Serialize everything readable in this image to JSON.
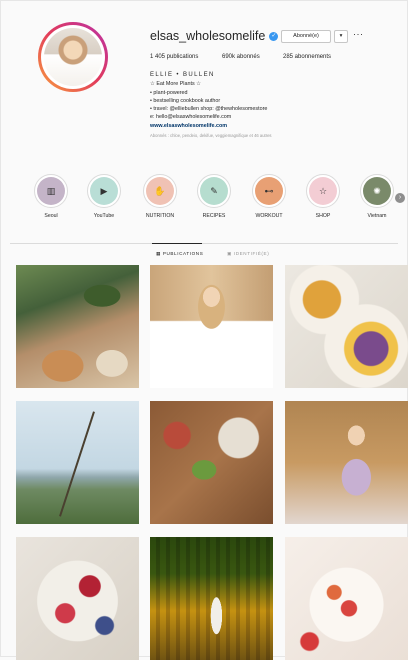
{
  "profile": {
    "username": "elsas_wholesomelife",
    "follow_label": "Abonné(e)",
    "dropdown_label": "▾",
    "more_label": "···",
    "stats": {
      "posts": "1 405 publications",
      "followers": "690k abonnés",
      "following": "285 abonnements"
    },
    "bio": {
      "name": "ELLIE • BULLEN",
      "lines": [
        "☆ Eat More Plants ☆",
        "• plant-powered",
        "• bestselling cookbook author",
        "• travel: @elliebullen shop: @thewholesomestore",
        "e: hello@elsaswholesomelife.com"
      ],
      "link": "www.elsaswholesomelife.com",
      "followed_by": "Abonnés : chloe, pendeio, dekifue, veggiemagnifique et 46 autres"
    }
  },
  "highlights": [
    {
      "label": "Seoul",
      "icon": "city-photo-icon",
      "color": "#c4b4c8",
      "glyph": "▥"
    },
    {
      "label": "YouTube",
      "icon": "play-icon",
      "color": "#b9ded6",
      "glyph": "▶"
    },
    {
      "label": "NUTRITION",
      "icon": "hand-icon",
      "color": "#f0c2b4",
      "glyph": "✋"
    },
    {
      "label": "RECIPES",
      "icon": "pencil-icon",
      "color": "#b6ddcf",
      "glyph": "✎"
    },
    {
      "label": "WORKOUT",
      "icon": "dumbbell-icon",
      "color": "#e8a074",
      "glyph": "⊷"
    },
    {
      "label": "SHOP",
      "icon": "star-icon",
      "color": "#f3cdd4",
      "glyph": "☆"
    },
    {
      "label": "Vietnam",
      "icon": "palm-photo-icon",
      "color": "#7a8a6a",
      "glyph": "✺"
    }
  ],
  "tabs": {
    "posts": "▦ PUBLICATIONS",
    "tagged": "▣ IDENTIFIÉ(E)"
  },
  "colors": {
    "verified": "#3897f0",
    "text": "#262626",
    "link": "#003569"
  }
}
